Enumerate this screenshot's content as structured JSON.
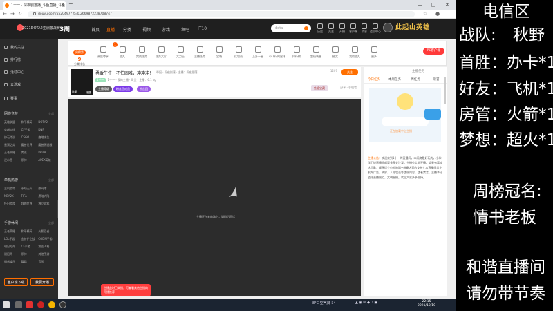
{
  "browser": {
    "tab_title": "1十一 · 深夜剧落播_斗鱼直播_斗鱼",
    "new_tab": "+",
    "url": "douyu.com/5520497?_t=0.2669872238708747",
    "win_min": "—",
    "win_max": "□",
    "win_close": "✕"
  },
  "site_header": {
    "logo_text": "2021DOTA2亚洲激战赛",
    "logo_badge": "3周",
    "nav": [
      "首页",
      "直播",
      "分类",
      "视频",
      "游戏",
      "鱼吧",
      "IT10"
    ],
    "search_placeholder": "dota",
    "icons": [
      "历史",
      "关注",
      "开播",
      "客户端",
      "消息",
      "会员中心"
    ],
    "hero_banner": "此起山英雄"
  },
  "sidebar": {
    "top_items": [
      "我的关注",
      "排行榜",
      "活动中心",
      "云游戏",
      "赛事"
    ],
    "sections": [
      {
        "title": "网游竞技",
        "more": "全部",
        "items": [
          "英雄联盟",
          "和平精英",
          "DOTA2",
          "穿越火线",
          "CF手游",
          "DNF",
          "炉石传说",
          "CSGO",
          "绝地求生",
          "云顶之弈",
          "魔兽世界",
          "魔兽怀旧服",
          "王者荣耀",
          "传说",
          "DOTA",
          "逆水寒",
          "原神",
          "APEX英雄"
        ]
      },
      {
        "title": "单机热游",
        "more": "全部",
        "items": [
          "主机游戏",
          "永劫无间",
          "数码港",
          "NBA2K",
          "FIFA",
          "黑暗大陆",
          "怀旧游戏",
          "我的世界",
          "独立游戏"
        ]
      },
      {
        "title": "手游休闲",
        "more": "全部",
        "items": [
          "王者荣耀",
          "和平精英",
          "火影忍者",
          "LOL手游",
          "金铲铲之战",
          "CODM手游",
          "明日方舟",
          "CF手游",
          "第五人格",
          "阴阳师",
          "原神",
          "其他手游",
          "情感娱乐",
          "舞蹈",
          "音乐"
        ]
      }
    ],
    "bottom_buttons": [
      "客户端下载",
      "我要开播"
    ]
  },
  "toolbar": {
    "rank_pill": "周榜第",
    "rank_num": "9",
    "rank_label": "分类排名",
    "redbadge": "1",
    "items": [
      "贵族尊享",
      "鱼丸",
      "完成任务",
      "任务大厅",
      "大力士",
      "主播任务",
      "宝箱",
      "红包雨",
      "上升一星",
      "小飞行的星球",
      "排行榜",
      "超级装备",
      "抽奖",
      "我的鱼丸",
      "更多"
    ],
    "pc_button": "PC客户端"
  },
  "room": {
    "anchor_name": "秋野",
    "anchor_level": "40",
    "title": "勇敢牛牛，不怕困难，冲冲冲！",
    "tags": "举报 · 深夜剧落 · 主播：深夜剧落",
    "category": "1十一",
    "meta": "1十一 · 我的主播 · 0 关 · 主播：6.1 kg",
    "btn_1": "主播等级",
    "btn_2": "粉丝团成员",
    "btn_3": "粉丝团",
    "follow_count": "1207",
    "follow": "关注",
    "gift_box": "鱼塘宝藏",
    "shares": "分享 · 手机看"
  },
  "player": {
    "loading_text": "主播正在来的路上，请稍后再试",
    "tip": "主播此时已关播，可查看其他主播的开播推荐"
  },
  "right_panel": {
    "top_row": "主播任务",
    "tabs": [
      "今日任务",
      "本周任务",
      "周任务",
      "荣誉"
    ],
    "img_text": "正在加载中心主播",
    "notice_tag": "主播公告：",
    "notice": "欢迎来到1十一的直播间，本间房是好玩的，小伙伴们进直播间都要多多关注我，主播会定期开播。如果有喜欢这首歌，顺便送个小礼物哦~感谢大家的支持！本直播间禁止发布广告、刷屏、人身攻击等违规内容，违者禁言。主播承诺遵守直播规范，文明直播。欢迎大家多多支持。"
  },
  "taskbar": {
    "weather": "8°C  空气良 54",
    "time": "22:15",
    "date": "2021/10/10"
  },
  "overlay": {
    "server": "电信区",
    "team_label": "战队:",
    "team_value": "秋野",
    "first_win": "首胜：办卡*1",
    "friend": "好友：飞机*1",
    "admin": "房管：火箭*1",
    "dream": "梦想：超火*1",
    "weekly_title": "周榜冠名:",
    "weekly_name": "情书老板",
    "rule_1": "和谐直播间",
    "rule_2": "请勿带节奏"
  },
  "colors": {
    "accent": "#ff6f00",
    "red": "#ff3e3e",
    "sidebar": "#2b2b2b",
    "header": "#1f1f1f",
    "player": "#2c2c2c"
  }
}
